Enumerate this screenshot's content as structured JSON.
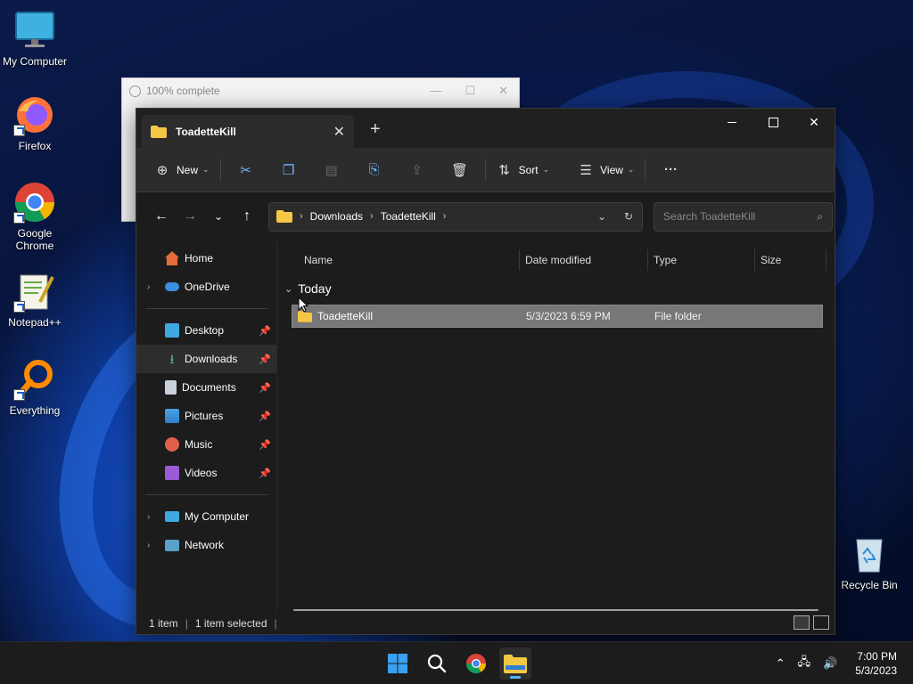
{
  "desktop": {
    "icons": [
      {
        "label": "My Computer"
      },
      {
        "label": "Firefox"
      },
      {
        "label": "Google Chrome"
      },
      {
        "label": "Notepad++"
      },
      {
        "label": "Everything"
      },
      {
        "label": "Recycle Bin"
      }
    ]
  },
  "progress_window": {
    "title": "100% complete"
  },
  "explorer": {
    "tab_title": "ToadetteKill",
    "new_tab_symbol": "+",
    "toolbar": {
      "new_label": "New",
      "sort_label": "Sort",
      "view_label": "View",
      "more_label": "···"
    },
    "address": {
      "crumbs": [
        "Downloads",
        "ToadetteKill"
      ]
    },
    "search": {
      "placeholder": "Search ToadetteKill"
    },
    "sidebar": {
      "items": [
        {
          "label": "Home"
        },
        {
          "label": "OneDrive"
        },
        {
          "label": "Desktop"
        },
        {
          "label": "Downloads"
        },
        {
          "label": "Documents"
        },
        {
          "label": "Pictures"
        },
        {
          "label": "Music"
        },
        {
          "label": "Videos"
        },
        {
          "label": "My Computer"
        },
        {
          "label": "Network"
        }
      ]
    },
    "columns": {
      "name": "Name",
      "date": "Date modified",
      "type": "Type",
      "size": "Size"
    },
    "group_label": "Today",
    "files": [
      {
        "name": "ToadetteKill",
        "date": "5/3/2023 6:59 PM",
        "type": "File folder",
        "size": ""
      }
    ],
    "status": {
      "count": "1 item",
      "selected": "1 item selected",
      "separator": "|"
    }
  },
  "taskbar": {
    "time": "7:00 PM",
    "date": "5/3/2023"
  },
  "colors": {
    "accent": "#5ab0ff",
    "folder": "#f4c744",
    "selection": "#777777"
  }
}
